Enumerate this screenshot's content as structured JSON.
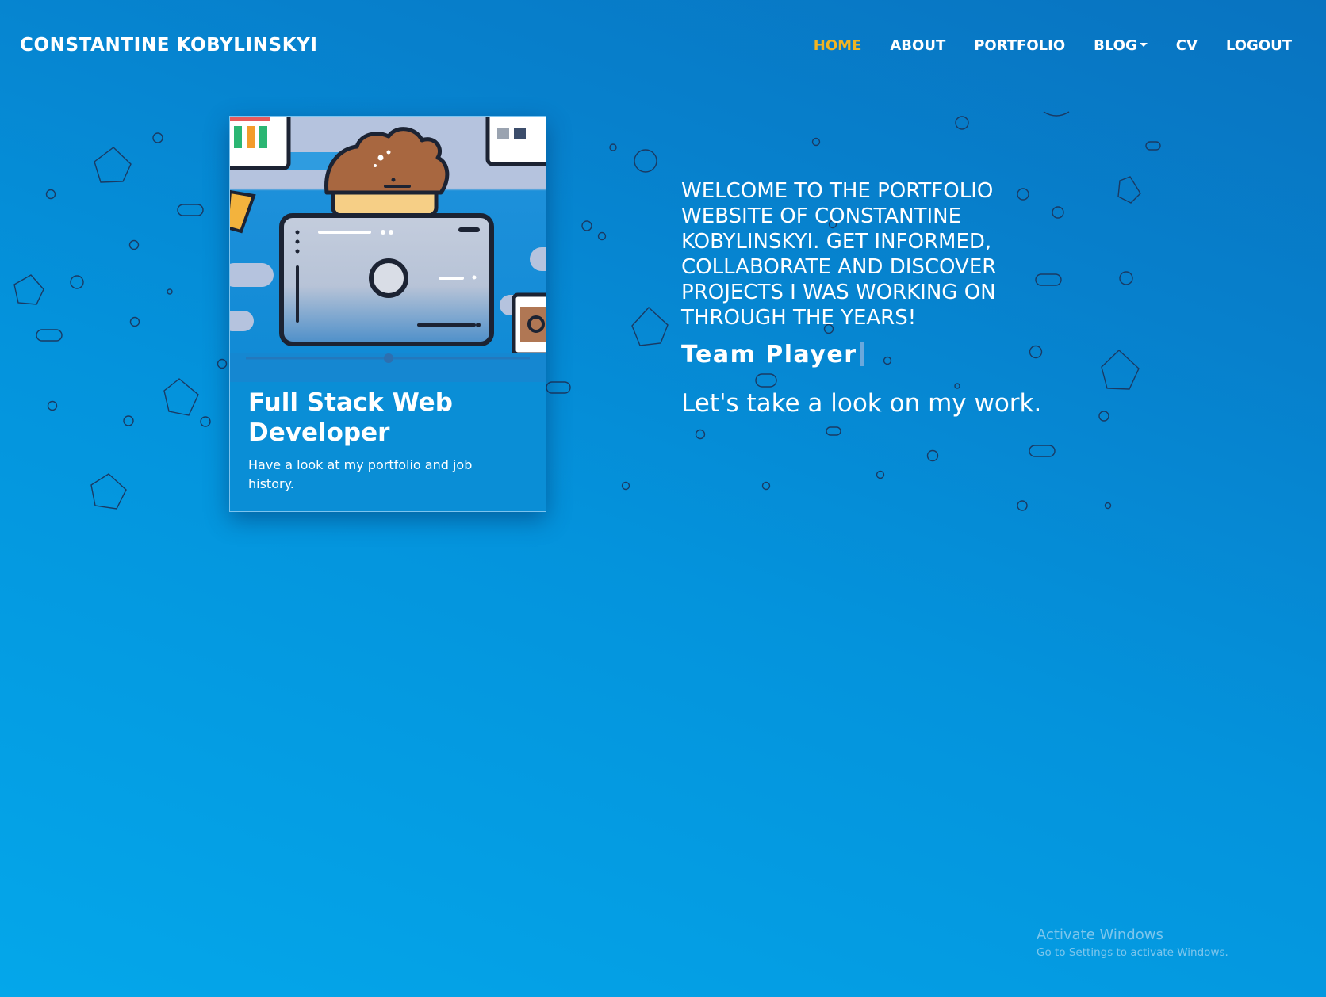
{
  "navbar": {
    "brand": "CONSTANTINE KOBYLINSKYI",
    "links": [
      {
        "label": "HOME",
        "active": true
      },
      {
        "label": "ABOUT",
        "active": false
      },
      {
        "label": "PORTFOLIO",
        "active": false
      },
      {
        "label": "BLOG",
        "active": false,
        "dropdown": true
      },
      {
        "label": "CV",
        "active": false
      },
      {
        "label": "LOGOUT",
        "active": false
      }
    ],
    "active_color": "#f0b423"
  },
  "card": {
    "title": "Full Stack Web Developer",
    "text": "Have a look at my portfolio and job history.",
    "illustration": "developer-at-computer-illustration"
  },
  "hero": {
    "welcome": "WELCOME TO THE PORTFOLIO WEBSITE OF CONSTANTINE KOBYLINSKYI. GET INFORMED, COLLABORATE AND DISCOVER PROJECTS I WAS WORKING ON THROUGH THE YEARS!",
    "typed_text": "Team Player",
    "tagline": "Let's take a look on my work."
  },
  "watermark": {
    "title": "Activate Windows",
    "subtitle": "Go to Settings to activate Windows."
  },
  "colors": {
    "background_top": "#0873c0",
    "background_bottom": "#04a7ea",
    "card_background": "#0a8ed6"
  }
}
